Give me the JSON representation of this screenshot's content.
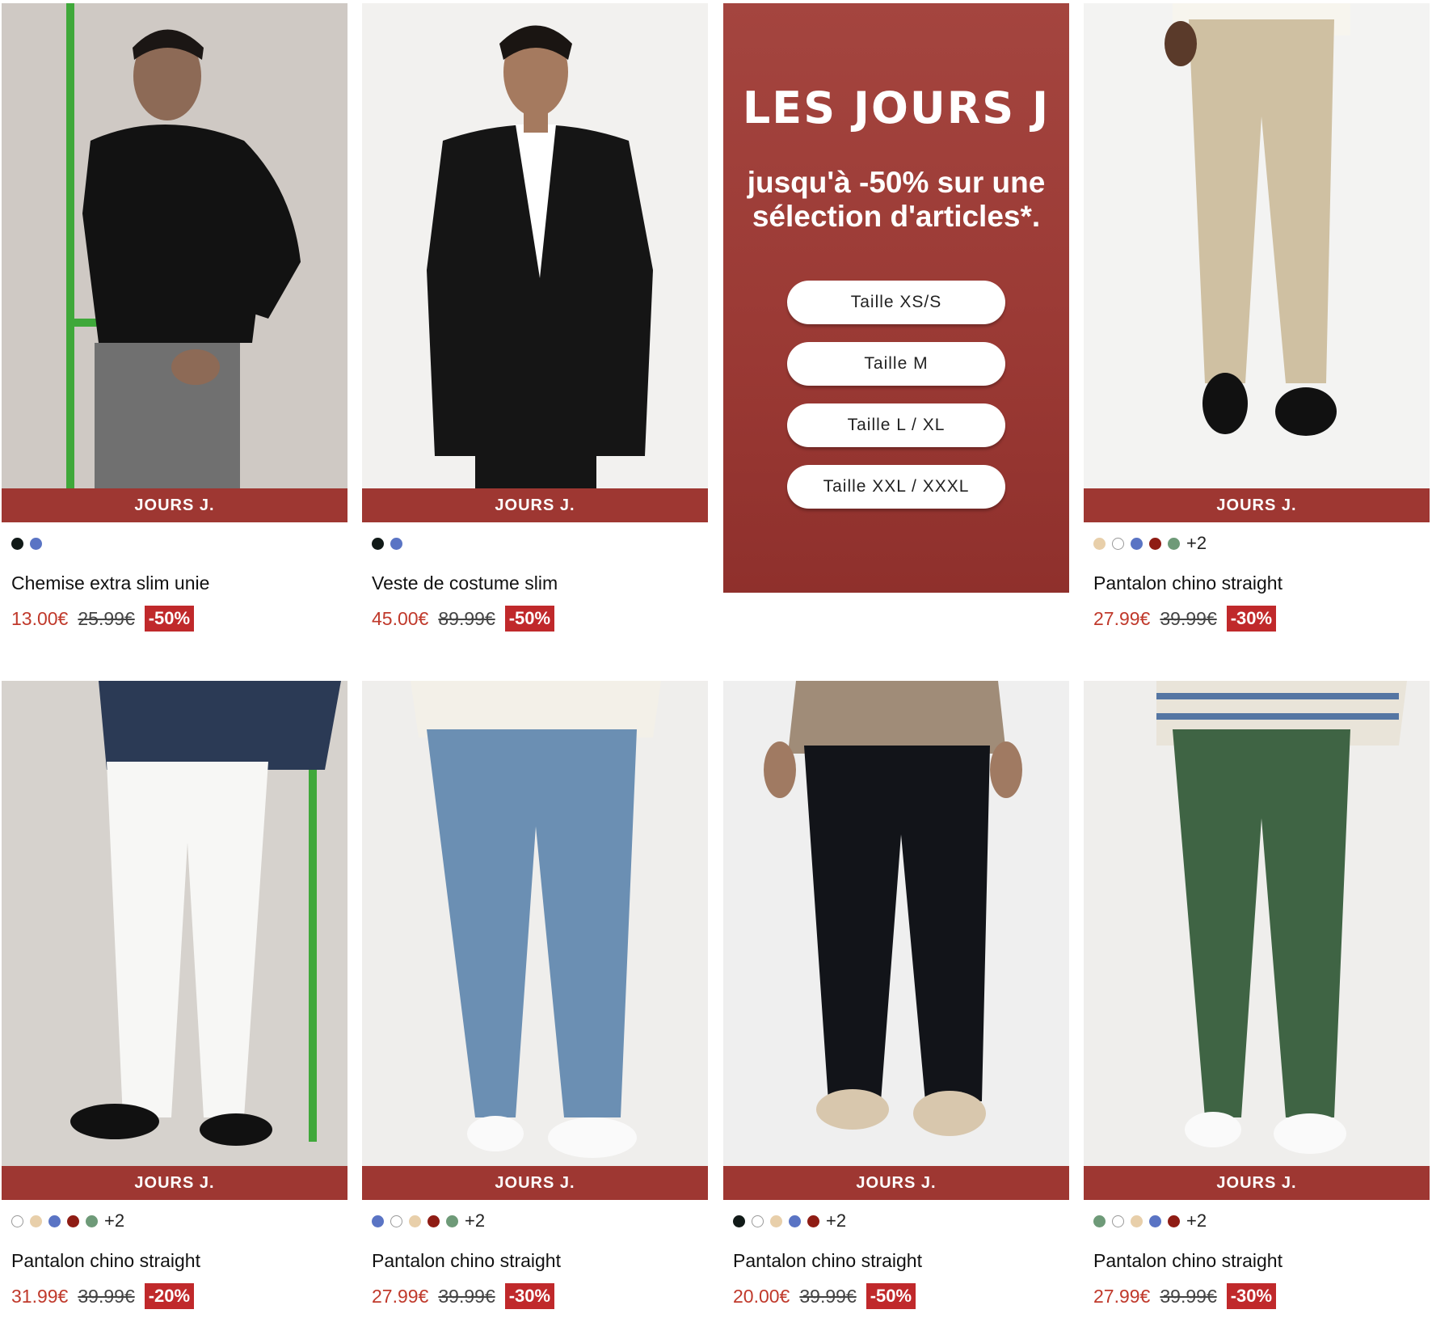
{
  "promo": {
    "title": "LES JOURS J",
    "subtitle": "jusqu'à -50% sur une sélection d'articles*.",
    "sizes": [
      "Taille XS/S",
      "Taille M",
      "Taille L / XL",
      "Taille XXL / XXXL"
    ]
  },
  "products": [
    {
      "ribbon": "JOURS J.",
      "swatches": [
        "#111a18",
        "#5a74c4"
      ],
      "more": "",
      "name": "Chemise extra slim unie",
      "price": "13.00€",
      "old_price": "25.99€",
      "discount": "-50%",
      "image": "black-shirt-model"
    },
    {
      "ribbon": "JOURS J.",
      "swatches": [
        "#111a18",
        "#5a74c4"
      ],
      "more": "",
      "name": "Veste de costume slim",
      "price": "45.00€",
      "old_price": "89.99€",
      "discount": "-50%",
      "image": "black-suit-jacket-model"
    },
    {
      "ribbon": "JOURS J.",
      "swatches": [
        "#e8cfaa",
        "#ffffff",
        "#5a74c4",
        "#8f1c14",
        "#6e9a78"
      ],
      "more": "+2",
      "name": "Pantalon chino straight",
      "price": "27.99€",
      "old_price": "39.99€",
      "discount": "-30%",
      "image": "beige-chino"
    },
    {
      "ribbon": "JOURS J.",
      "swatches": [
        "#ffffff",
        "#e8cfaa",
        "#5a74c4",
        "#8f1c14",
        "#6e9a78"
      ],
      "more": "+2",
      "name": "Pantalon chino straight",
      "price": "31.99€",
      "old_price": "39.99€",
      "discount": "-20%",
      "image": "white-chino"
    },
    {
      "ribbon": "JOURS J.",
      "swatches": [
        "#5a74c4",
        "#ffffff",
        "#e8cfaa",
        "#8f1c14",
        "#6e9a78"
      ],
      "more": "+2",
      "name": "Pantalon chino straight",
      "price": "27.99€",
      "old_price": "39.99€",
      "discount": "-30%",
      "image": "blue-chino"
    },
    {
      "ribbon": "JOURS J.",
      "swatches": [
        "#111a18",
        "#ffffff",
        "#e8cfaa",
        "#5a74c4",
        "#8f1c14"
      ],
      "more": "+2",
      "name": "Pantalon chino straight",
      "price": "20.00€",
      "old_price": "39.99€",
      "discount": "-50%",
      "image": "black-chino"
    },
    {
      "ribbon": "JOURS J.",
      "swatches": [
        "#6e9a78",
        "#ffffff",
        "#e8cfaa",
        "#5a74c4",
        "#8f1c14"
      ],
      "more": "+2",
      "name": "Pantalon chino straight",
      "price": "27.99€",
      "old_price": "39.99€",
      "discount": "-30%",
      "image": "green-chino"
    }
  ]
}
